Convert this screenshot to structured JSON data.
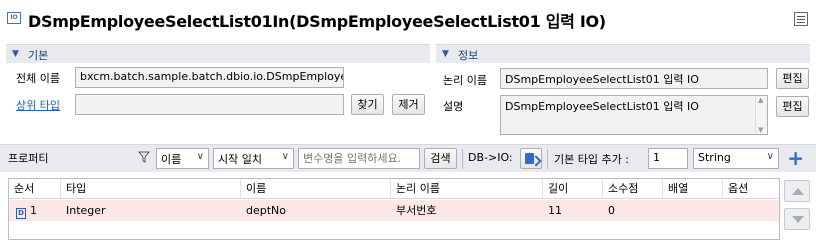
{
  "title": "DSmpEmployeeSelectList01In(DSmpEmployeeSelectList01 입력 IO)",
  "title_icon_text": "IO",
  "basic": {
    "section_label": "기본",
    "fullname_label": "전체 이름",
    "fullname_value": "bxcm.batch.sample.batch.dbio.io.DSmpEmployee",
    "parent_type_label": "상위 타입",
    "parent_type_value": "",
    "find_button": "찾기",
    "remove_button": "제거"
  },
  "info": {
    "section_label": "정보",
    "logical_name_label": "논리 이름",
    "logical_name_value": "DSmpEmployeeSelectList01 입력 IO",
    "logical_edit_button": "편집",
    "description_label": "설명",
    "description_value": "DSmpEmployeeSelectList01 입력 IO",
    "description_edit_button": "편집"
  },
  "toolbar": {
    "properties_label": "프로퍼티",
    "filter_field_value": "이름",
    "match_mode_value": "시작 일치",
    "search_placeholder": "변수명을 입력하세요.",
    "search_button": "검색",
    "db_io_label": "DB->IO:",
    "default_type_add_label": "기본 타입 추가 :",
    "default_type_count": "1",
    "type_select_value": "String"
  },
  "table": {
    "headers": [
      "순서",
      "타입",
      "이름",
      "논리 이름",
      "길이",
      "소수점",
      "배열",
      "옵션"
    ],
    "rows": [
      {
        "order": "1",
        "type": "Integer",
        "name": "deptNo",
        "logical_name": "부서번호",
        "length": "11",
        "decimal": "0",
        "array": "",
        "option": ""
      }
    ],
    "row_icon_text": "D"
  },
  "colors": {
    "section_bg": "#e8eaef",
    "accent_blue": "#2a5ab0",
    "selected_row": "#fde8e8",
    "link": "#1f5fbf"
  }
}
